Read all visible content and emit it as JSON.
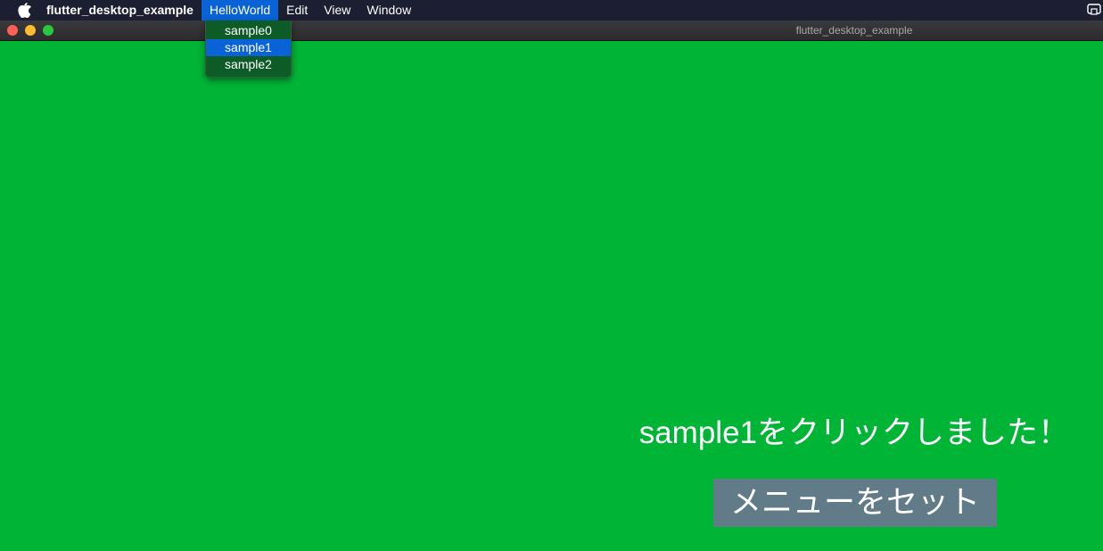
{
  "menubar": {
    "app_name": "flutter_desktop_example",
    "items": [
      {
        "label": "HelloWorld"
      },
      {
        "label": "Edit"
      },
      {
        "label": "View"
      },
      {
        "label": "Window"
      }
    ]
  },
  "window": {
    "title": "flutter_desktop_example"
  },
  "dropdown": {
    "items": [
      {
        "label": "sample0"
      },
      {
        "label": "sample1"
      },
      {
        "label": "sample2"
      }
    ],
    "highlighted": "sample1"
  },
  "content": {
    "message": "sample1をクリックしました！",
    "button_label": "メニューをセット"
  },
  "colors": {
    "background": "#00b436",
    "button": "#627b89",
    "menu_highlight": "#0a63d6",
    "dropdown_bg": "#0d5b26"
  }
}
